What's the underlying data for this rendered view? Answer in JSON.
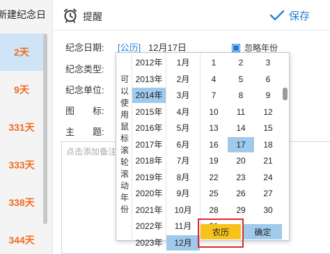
{
  "sidebar": {
    "new_label": "新建纪念日",
    "days": [
      "2天",
      "9天",
      "331天",
      "333天",
      "338天",
      "344天"
    ]
  },
  "topbar": {
    "remind_label": "提醒",
    "save_label": "保存"
  },
  "form": {
    "date_label": "纪念日期:",
    "calendar_type": "[公历]",
    "date_value": "12月17日",
    "ignore_year_label": "忽略年份",
    "type_label": "纪念类型:",
    "unit_label": "纪念单位:",
    "icon_label": "图　　标:",
    "subject_label": "主　　题:",
    "note_placeholder": "点击添加备注"
  },
  "picker": {
    "hint": "可以使用鼠标滚轮滚动年份",
    "years": [
      "2012年",
      "2013年",
      "2014年",
      "2015年",
      "2016年",
      "2017年",
      "2018年",
      "2019年",
      "2020年",
      "2021年",
      "2022年",
      "2023年"
    ],
    "selected_year": "2014年",
    "months": [
      "1月",
      "2月",
      "3月",
      "4月",
      "5月",
      "6月",
      "7月",
      "8月",
      "9月",
      "10月",
      "11月",
      "12月"
    ],
    "selected_month": "12月",
    "days": [
      "1",
      "2",
      "3",
      "4",
      "5",
      "6",
      "7",
      "8",
      "9",
      "10",
      "11",
      "12",
      "13",
      "14",
      "15",
      "16",
      "17",
      "18",
      "19",
      "20",
      "21",
      "22",
      "23",
      "24",
      "25",
      "26",
      "27",
      "28",
      "29",
      "30",
      "31"
    ],
    "selected_day": "17",
    "lunar_label": "农历",
    "ok_label": "确定"
  },
  "colors": {
    "accent": "#2a7fd4",
    "days_orange": "#ef6c22",
    "selection": "#9fcaec",
    "lunar_button": "#f7c21b",
    "highlight": "#e0262c"
  }
}
